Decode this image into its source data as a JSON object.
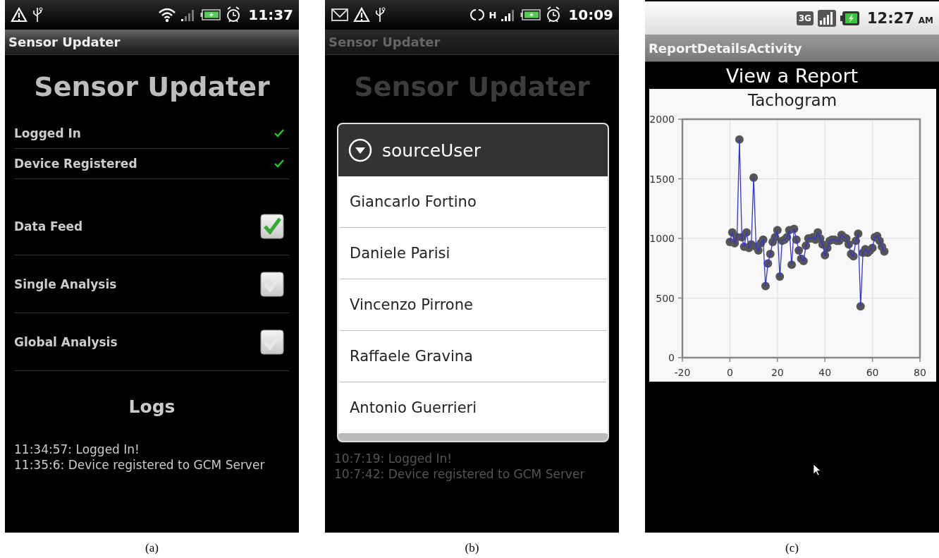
{
  "panel_a": {
    "status_bar": {
      "time": "11:37"
    },
    "title_bar": "Sensor Updater",
    "heading": "Sensor Updater",
    "status_items": [
      {
        "label": "Logged In",
        "ok": true
      },
      {
        "label": "Device Registered",
        "ok": true
      }
    ],
    "toggles": [
      {
        "label": "Data Feed",
        "checked": true
      },
      {
        "label": "Single Analysis",
        "checked": false
      },
      {
        "label": "Global Analysis",
        "checked": false
      }
    ],
    "logs_heading": "Logs",
    "logs": [
      "11:34:57: Logged In!",
      "11:35:6: Device registered to GCM Server"
    ],
    "caption": "(a)"
  },
  "panel_b": {
    "status_bar": {
      "network": "H",
      "time": "10:09"
    },
    "title_bar": "Sensor Updater",
    "heading": "Sensor Updater",
    "dialog": {
      "title": "sourceUser",
      "options": [
        "Giancarlo Fortino",
        "Daniele Parisi",
        "Vincenzo Pirrone",
        "Raffaele Gravina",
        "Antonio Guerrieri"
      ]
    },
    "logs": [
      "10:7:19: Logged In!",
      "10:7:42: Device registered to GCM Server"
    ],
    "caption": "(b)"
  },
  "panel_c": {
    "status_bar": {
      "network": "3G",
      "time": "12:27",
      "suffix": "AM"
    },
    "title_bar": "ReportDetailsActivity",
    "heading": "View a Report",
    "chart_data": {
      "type": "line",
      "title": "Tachogram",
      "xlim": [
        -20,
        80
      ],
      "ylim": [
        0,
        2000
      ],
      "xticks": [
        -20,
        0,
        20,
        40,
        60,
        80
      ],
      "yticks": [
        0,
        500,
        1000,
        1500,
        2000
      ],
      "x": [
        0,
        1,
        2,
        3,
        4,
        5,
        6,
        7,
        8,
        9,
        10,
        11,
        12,
        13,
        14,
        15,
        16,
        17,
        18,
        19,
        20,
        21,
        22,
        23,
        24,
        25,
        26,
        27,
        28,
        29,
        30,
        31,
        32,
        33,
        34,
        35,
        36,
        37,
        38,
        39,
        40,
        41,
        42,
        43,
        44,
        45,
        46,
        47,
        48,
        49,
        50,
        51,
        52,
        53,
        54,
        55,
        56,
        57,
        58,
        59,
        60,
        61,
        62,
        63,
        64,
        65
      ],
      "grid": true,
      "series": [
        {
          "color": "#3333dd",
          "marker": "circle",
          "values": [
            970,
            1050,
            960,
            1010,
            1830,
            1010,
            930,
            1050,
            920,
            950,
            1510,
            930,
            900,
            960,
            990,
            600,
            790,
            870,
            970,
            1010,
            1070,
            680,
            980,
            990,
            1010,
            1070,
            780,
            1080,
            990,
            900,
            830,
            810,
            940,
            1000,
            1000,
            1010,
            990,
            1050,
            1000,
            950,
            860,
            920,
            980,
            990,
            990,
            980,
            980,
            1030,
            1010,
            1000,
            950,
            870,
            850,
            980,
            1040,
            430,
            880,
            910,
            880,
            900,
            920,
            1010,
            1020,
            980,
            930,
            890
          ]
        }
      ]
    },
    "caption": "(c)"
  }
}
